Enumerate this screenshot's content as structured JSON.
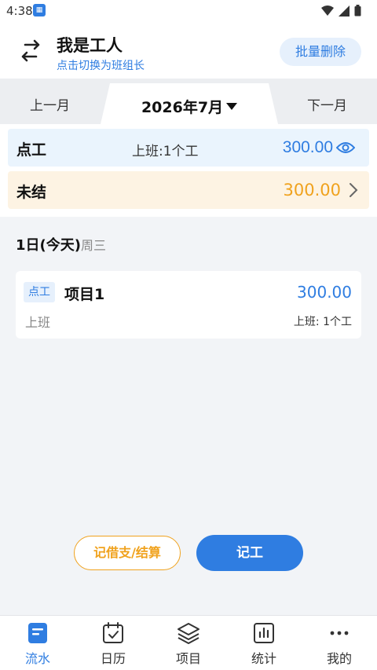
{
  "status_bar": {
    "time": "4:38"
  },
  "header": {
    "title": "我是工人",
    "subtitle": "点击切换为班组长",
    "batch_delete": "批量删除"
  },
  "month_nav": {
    "prev": "上一月",
    "current": "2026年7月",
    "next": "下一月"
  },
  "summary": {
    "dian_label": "点工",
    "dian_detail": "上班:1个工",
    "dian_amount": "300.00",
    "unsettled_label": "未结",
    "unsettled_amount": "300.00"
  },
  "day": {
    "date_label": "1日(今天)",
    "weekday": "周三"
  },
  "records": [
    {
      "tag": "点工",
      "project": "项目1",
      "amount": "300.00",
      "kind": "上班",
      "detail": "上班: 1个工"
    }
  ],
  "actions": {
    "borrow_settle": "记借支/结算",
    "record_work": "记工"
  },
  "tabs": [
    {
      "label": "流水",
      "icon": "list-doc-icon",
      "active": true
    },
    {
      "label": "日历",
      "icon": "calendar-check-icon",
      "active": false
    },
    {
      "label": "项目",
      "icon": "layers-icon",
      "active": false
    },
    {
      "label": "统计",
      "icon": "bar-chart-icon",
      "active": false
    },
    {
      "label": "我的",
      "icon": "more-dots-icon",
      "active": false
    }
  ],
  "colors": {
    "primary": "#2f7de1",
    "accent_orange": "#f0a21d",
    "dian_bg": "#eaf4fd",
    "unsettled_bg": "#fdf3e3"
  }
}
